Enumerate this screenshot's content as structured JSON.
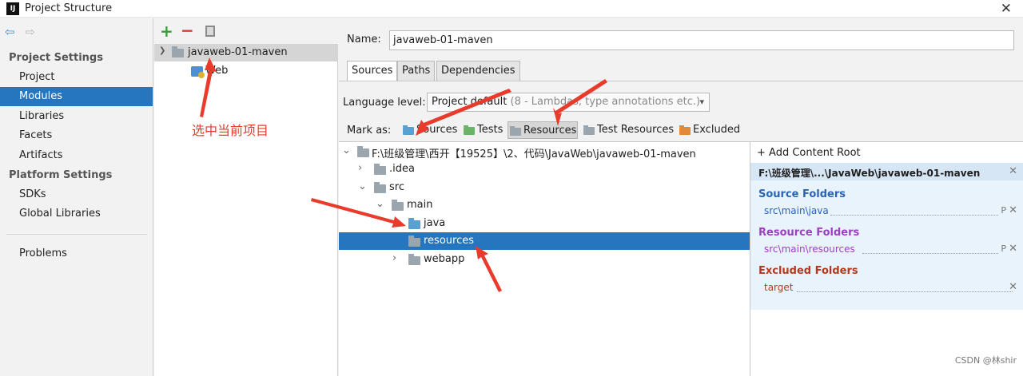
{
  "window": {
    "app_icon": "intellij-icon",
    "title": "Project Structure",
    "close_icon": "close-icon",
    "close_glyph": "✕"
  },
  "left_nav": {
    "back_glyph": "⇦",
    "forward_glyph": "⇨",
    "project_settings_header": "Project Settings",
    "project_settings": [
      "Project",
      "Modules",
      "Libraries",
      "Facets",
      "Artifacts"
    ],
    "platform_settings_header": "Platform Settings",
    "platform_settings": [
      "SDKs",
      "Global Libraries"
    ],
    "problems": "Problems",
    "selected": "Modules"
  },
  "module_tree": {
    "add_glyph": "+",
    "remove_glyph": "−",
    "root_module": "javaweb-01-maven",
    "child_facet": "Web",
    "annotation": "选中当前项目"
  },
  "module_editor": {
    "name_label": "Name:",
    "name_value": "javaweb-01-maven",
    "tabs": [
      "Sources",
      "Paths",
      "Dependencies"
    ],
    "active_tab": "Sources",
    "language_level_label": "Language level:",
    "language_level_value": "Project default",
    "language_level_hint": "(8 - Lambdas, type annotations etc.)",
    "mark_as_label": "Mark as:",
    "mark_as_buttons": [
      {
        "label": "Sources",
        "color": "#5aa0d0"
      },
      {
        "label": "Tests",
        "color": "#6cb36a"
      },
      {
        "label": "Resources",
        "color": "#9aa5ad"
      },
      {
        "label": "Test Resources",
        "color": "#9aa5ad"
      },
      {
        "label": "Excluded",
        "color": "#e08a3c"
      }
    ],
    "pressed_mark": "Resources"
  },
  "source_tree": {
    "rows": [
      {
        "label": "F:\\班级管理\\西开【19525】\\2、代码\\JavaWeb\\javaweb-01-maven",
        "expanded": true
      },
      {
        "label": ".idea",
        "expanded": false
      },
      {
        "label": "src",
        "expanded": true
      },
      {
        "label": "main",
        "expanded": true
      },
      {
        "label": "java",
        "type": "source"
      },
      {
        "label": "resources",
        "type": "resource",
        "selected": true
      },
      {
        "label": "webapp",
        "expanded": false
      }
    ]
  },
  "content_roots": {
    "add_label": "Add Content Root",
    "root_path": "F:\\班级管理\\...\\JavaWeb\\javaweb-01-maven",
    "source_folders_title": "Source Folders",
    "source_folders": [
      "src\\main\\java"
    ],
    "resource_folders_title": "Resource Folders",
    "resource_folders": [
      "src\\main\\resources"
    ],
    "excluded_folders_title": "Excluded Folders",
    "excluded_folders": [
      "target"
    ],
    "colors": {
      "source": "#2a63b4",
      "resource": "#9b3fc4",
      "excluded": "#b33a1f"
    }
  },
  "watermark": "CSDN @林shir"
}
